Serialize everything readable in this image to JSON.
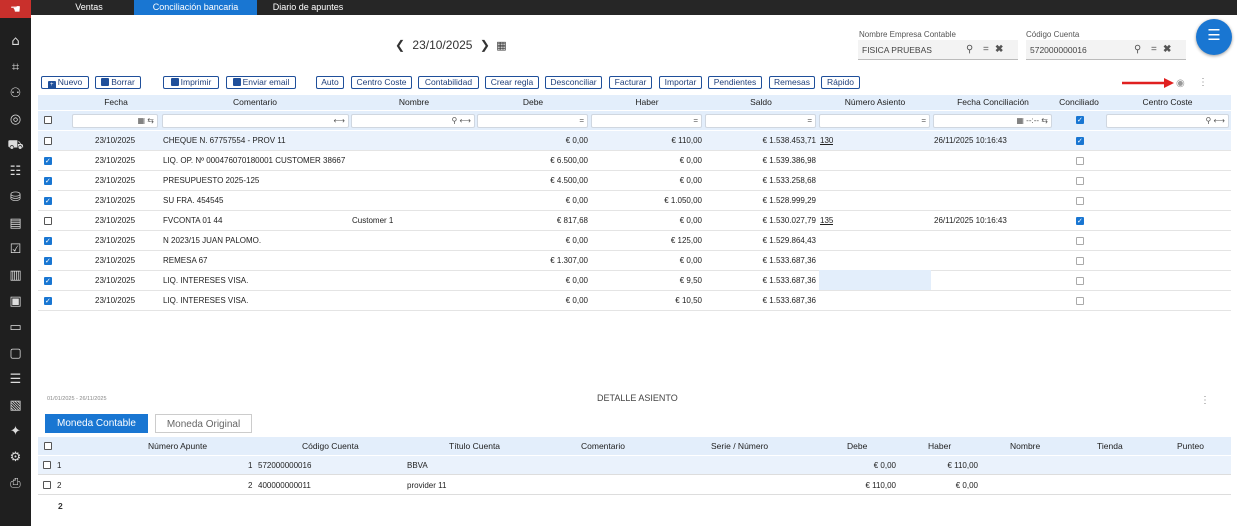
{
  "sidebar": {
    "icons": [
      "hand-pointer-icon",
      "home-icon",
      "tag-icon",
      "users-icon",
      "target-icon",
      "truck-icon",
      "contacts-icon",
      "coins-icon",
      "calculator-icon",
      "checklist-icon",
      "chart-icon",
      "id-card-icon",
      "register-icon",
      "monitor-icon",
      "ledger-icon",
      "document-settings-icon",
      "sparkle-icon",
      "gear-icon",
      "export-icon"
    ]
  },
  "tabs": [
    "Ventas",
    "Conciliación bancaria",
    "Diario de apuntes"
  ],
  "date_nav": {
    "date": "23/10/2025"
  },
  "company": {
    "label": "Nombre Empresa Contable",
    "value": "FISICA PRUEBAS"
  },
  "account": {
    "label": "Código Cuenta",
    "value": "572000000016"
  },
  "toolbar": [
    "Nuevo",
    "Borrar",
    "Imprimir",
    "Enviar email",
    "Auto",
    "Centro Coste",
    "Contabilidad",
    "Crear regla",
    "Desconciliar",
    "Facturar",
    "Importar",
    "Pendientes",
    "Remesas",
    "Rápido"
  ],
  "grid": {
    "columns": [
      "Fecha",
      "Comentario",
      "Nombre",
      "Debe",
      "Haber",
      "Saldo",
      "Número Asiento",
      "Fecha Conciliación",
      "Conciliado",
      "Centro Coste"
    ],
    "filter_eq": "=",
    "filter_range": "--:--",
    "rows": [
      {
        "checked": false,
        "fecha": "23/10/2025",
        "comentario": "CHEQUE N. 67757554 - PROV 11",
        "nombre": "",
        "debe": "€ 0,00",
        "haber": "€ 110,00",
        "saldo": "€ 1.538.453,71",
        "asiento": "130",
        "fecha_conc": "26/11/2025 10:16:43",
        "conciliado": true
      },
      {
        "checked": true,
        "fecha": "23/10/2025",
        "comentario": "LIQ. OP. Nº 000476070180001 CUSTOMER 38667",
        "nombre": "",
        "debe": "€ 6.500,00",
        "haber": "€ 0,00",
        "saldo": "€ 1.539.386,98",
        "asiento": "",
        "fecha_conc": "",
        "conciliado": false
      },
      {
        "checked": true,
        "fecha": "23/10/2025",
        "comentario": "PRESUPUESTO 2025-125",
        "nombre": "",
        "debe": "€ 4.500,00",
        "haber": "€ 0,00",
        "saldo": "€ 1.533.258,68",
        "asiento": "",
        "fecha_conc": "",
        "conciliado": false
      },
      {
        "checked": true,
        "fecha": "23/10/2025",
        "comentario": "SU FRA. 454545",
        "nombre": "",
        "debe": "€ 0,00",
        "haber": "€ 1.050,00",
        "saldo": "€ 1.528.999,29",
        "asiento": "",
        "fecha_conc": "",
        "conciliado": false
      },
      {
        "checked": false,
        "fecha": "23/10/2025",
        "comentario": "FVCONTA 01 44",
        "nombre": "Customer 1",
        "debe": "€ 817,68",
        "haber": "€ 0,00",
        "saldo": "€ 1.530.027,79",
        "asiento": "135",
        "fecha_conc": "26/11/2025 10:16:43",
        "conciliado": true
      },
      {
        "checked": true,
        "fecha": "23/10/2025",
        "comentario": "N 2023/15 JUAN PALOMO.",
        "nombre": "",
        "debe": "€ 0,00",
        "haber": "€ 125,00",
        "saldo": "€ 1.529.864,43",
        "asiento": "",
        "fecha_conc": "",
        "conciliado": false
      },
      {
        "checked": true,
        "fecha": "23/10/2025",
        "comentario": "REMESA 67",
        "nombre": "",
        "debe": "€ 1.307,00",
        "haber": "€ 0,00",
        "saldo": "€ 1.533.687,36",
        "asiento": "",
        "fecha_conc": "",
        "conciliado": false
      },
      {
        "checked": true,
        "fecha": "23/10/2025",
        "comentario": "LIQ. INTERESES VISA.",
        "nombre": "",
        "debe": "€ 0,00",
        "haber": "€ 9,50",
        "saldo": "€ 1.533.687,36",
        "asiento": "",
        "fecha_conc": "",
        "conciliado": false
      },
      {
        "checked": true,
        "fecha": "23/10/2025",
        "comentario": "LIQ. INTERESES VISA.",
        "nombre": "",
        "debe": "€ 0,00",
        "haber": "€ 10,50",
        "saldo": "€ 1.533.687,36",
        "asiento": "",
        "fecha_conc": "",
        "conciliado": false
      }
    ]
  },
  "period": "01/01/2025 - 26/11/2025",
  "detail": {
    "title": "DETALLE ASIENTO",
    "tabs": [
      "Moneda Contable",
      "Moneda Original"
    ],
    "columns": [
      "Número Apunte",
      "Código Cuenta",
      "Título Cuenta",
      "Comentario",
      "Serie / Número",
      "Debe",
      "Haber",
      "Nombre",
      "Tienda",
      "Punteo"
    ],
    "rows": [
      {
        "idx": "1",
        "num": "1",
        "cuenta": "572000000016",
        "titulo": "BBVA",
        "debe": "€ 0,00",
        "haber": "€ 110,00"
      },
      {
        "idx": "2",
        "num": "2",
        "cuenta": "400000000011",
        "titulo": "provider 11",
        "debe": "€ 110,00",
        "haber": "€ 0,00"
      }
    ],
    "count": "2"
  },
  "colors": {
    "accent": "#1976d2",
    "annotation_arrow": "#e02020"
  }
}
